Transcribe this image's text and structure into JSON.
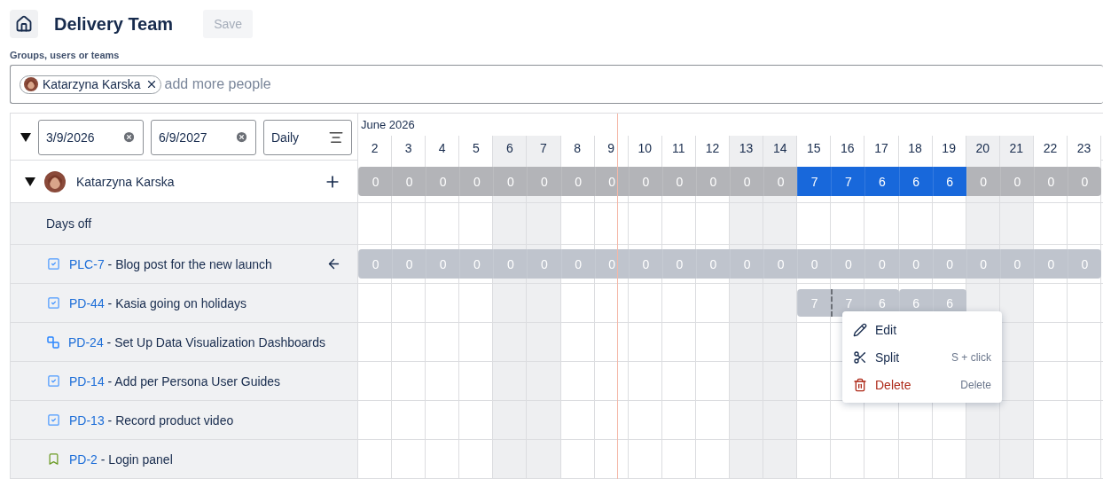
{
  "header": {
    "title": "Delivery Team",
    "save": {
      "label": "Save",
      "disabled": true
    }
  },
  "people_field": {
    "label": "Groups, users or teams",
    "chips": [
      {
        "name": "Katarzyna Karska"
      }
    ],
    "placeholder": "add more people"
  },
  "filters": {
    "expanded": true,
    "start_date": "3/9/2026",
    "end_date": "6/9/2027",
    "scale": "Daily"
  },
  "month": "June 2026",
  "days": [
    {
      "label": "2",
      "weekend": false,
      "today": false
    },
    {
      "label": "3",
      "weekend": false,
      "today": false
    },
    {
      "label": "4",
      "weekend": false,
      "today": false
    },
    {
      "label": "5",
      "weekend": false,
      "today": false
    },
    {
      "label": "6",
      "weekend": true,
      "today": false
    },
    {
      "label": "7",
      "weekend": true,
      "today": false
    },
    {
      "label": "8",
      "weekend": false,
      "today": false
    },
    {
      "label": "9",
      "weekend": false,
      "today": true
    },
    {
      "label": "10",
      "weekend": false,
      "today": false
    },
    {
      "label": "11",
      "weekend": false,
      "today": false
    },
    {
      "label": "12",
      "weekend": false,
      "today": false
    },
    {
      "label": "13",
      "weekend": true,
      "today": false
    },
    {
      "label": "14",
      "weekend": true,
      "today": false
    },
    {
      "label": "15",
      "weekend": false,
      "today": false
    },
    {
      "label": "16",
      "weekend": false,
      "today": false
    },
    {
      "label": "17",
      "weekend": false,
      "today": false
    },
    {
      "label": "18",
      "weekend": false,
      "today": false
    },
    {
      "label": "19",
      "weekend": false,
      "today": false
    },
    {
      "label": "20",
      "weekend": true,
      "today": false
    },
    {
      "label": "21",
      "weekend": true,
      "today": false
    },
    {
      "label": "22",
      "weekend": false,
      "today": false
    },
    {
      "label": "23",
      "weekend": false,
      "today": false
    }
  ],
  "person": {
    "name": "Katarzyna Karska",
    "expanded": true,
    "hours": [
      {
        "value": "0",
        "highlighted": false
      },
      {
        "value": "0",
        "highlighted": false
      },
      {
        "value": "0",
        "highlighted": false
      },
      {
        "value": "0",
        "highlighted": false
      },
      {
        "value": "0",
        "highlighted": false
      },
      {
        "value": "0",
        "highlighted": false
      },
      {
        "value": "0",
        "highlighted": false
      },
      {
        "value": "0",
        "highlighted": false
      },
      {
        "value": "0",
        "highlighted": false
      },
      {
        "value": "0",
        "highlighted": false
      },
      {
        "value": "0",
        "highlighted": false
      },
      {
        "value": "0",
        "highlighted": false
      },
      {
        "value": "0",
        "highlighted": false
      },
      {
        "value": "7",
        "highlighted": true
      },
      {
        "value": "7",
        "highlighted": true
      },
      {
        "value": "6",
        "highlighted": true
      },
      {
        "value": "6",
        "highlighted": true
      },
      {
        "value": "6",
        "highlighted": true
      },
      {
        "value": "0",
        "highlighted": false
      },
      {
        "value": "0",
        "highlighted": false
      },
      {
        "value": "0",
        "highlighted": false
      },
      {
        "value": "0",
        "highlighted": false
      }
    ]
  },
  "rows": [
    {
      "kind": "days_off",
      "label": "Days off"
    },
    {
      "kind": "task",
      "key": "PLC-7",
      "title": " - Blog post for the new launch",
      "pinned": true,
      "hours": [
        {
          "filled": true,
          "value": "0"
        },
        {
          "filled": true,
          "value": "0"
        },
        {
          "filled": true,
          "value": "0"
        },
        {
          "filled": true,
          "value": "0"
        },
        {
          "filled": true,
          "value": "0"
        },
        {
          "filled": true,
          "value": "0"
        },
        {
          "filled": true,
          "value": "0"
        },
        {
          "filled": true,
          "value": "0"
        },
        {
          "filled": true,
          "value": "0"
        },
        {
          "filled": true,
          "value": "0"
        },
        {
          "filled": true,
          "value": "0"
        },
        {
          "filled": true,
          "value": "0"
        },
        {
          "filled": true,
          "value": "0"
        },
        {
          "filled": true,
          "value": "0"
        },
        {
          "filled": true,
          "value": "0"
        },
        {
          "filled": true,
          "value": "0"
        },
        {
          "filled": true,
          "value": "0"
        },
        {
          "filled": true,
          "value": "0"
        },
        {
          "filled": true,
          "value": "0"
        },
        {
          "filled": true,
          "value": "0"
        },
        {
          "filled": true,
          "value": "0"
        },
        {
          "filled": true,
          "value": "0"
        }
      ]
    },
    {
      "kind": "task",
      "key": "PD-44",
      "title": " - Kasia going on holidays",
      "hours": [
        {
          "filled": false
        },
        {
          "filled": false
        },
        {
          "filled": false
        },
        {
          "filled": false
        },
        {
          "filled": false
        },
        {
          "filled": false
        },
        {
          "filled": false
        },
        {
          "filled": false
        },
        {
          "filled": false
        },
        {
          "filled": false
        },
        {
          "filled": false
        },
        {
          "filled": false
        },
        {
          "filled": false
        },
        {
          "filled": true,
          "value": "7",
          "start": true
        },
        {
          "filled": true,
          "value": "7",
          "split": true
        },
        {
          "filled": true,
          "value": "6"
        },
        {
          "filled": true,
          "value": "6",
          "start": true
        },
        {
          "filled": true,
          "value": "6"
        },
        {
          "filled": false
        },
        {
          "filled": false
        },
        {
          "filled": false
        },
        {
          "filled": false
        }
      ]
    },
    {
      "kind": "subtask",
      "key": "PD-24",
      "title": " - Set Up Data Visualization Dashboards"
    },
    {
      "kind": "task",
      "key": "PD-14",
      "title": " - Add per Persona User Guides"
    },
    {
      "kind": "task",
      "key": "PD-13",
      "title": " - Record product video"
    },
    {
      "kind": "story",
      "key": "PD-2",
      "title": " - Login panel"
    }
  ],
  "context_menu": [
    {
      "label": "Edit",
      "kind": "edit"
    },
    {
      "label": "Split",
      "kind": "split",
      "shortcut": "S + click"
    },
    {
      "label": "Delete",
      "kind": "delete",
      "shortcut": "Delete"
    }
  ]
}
